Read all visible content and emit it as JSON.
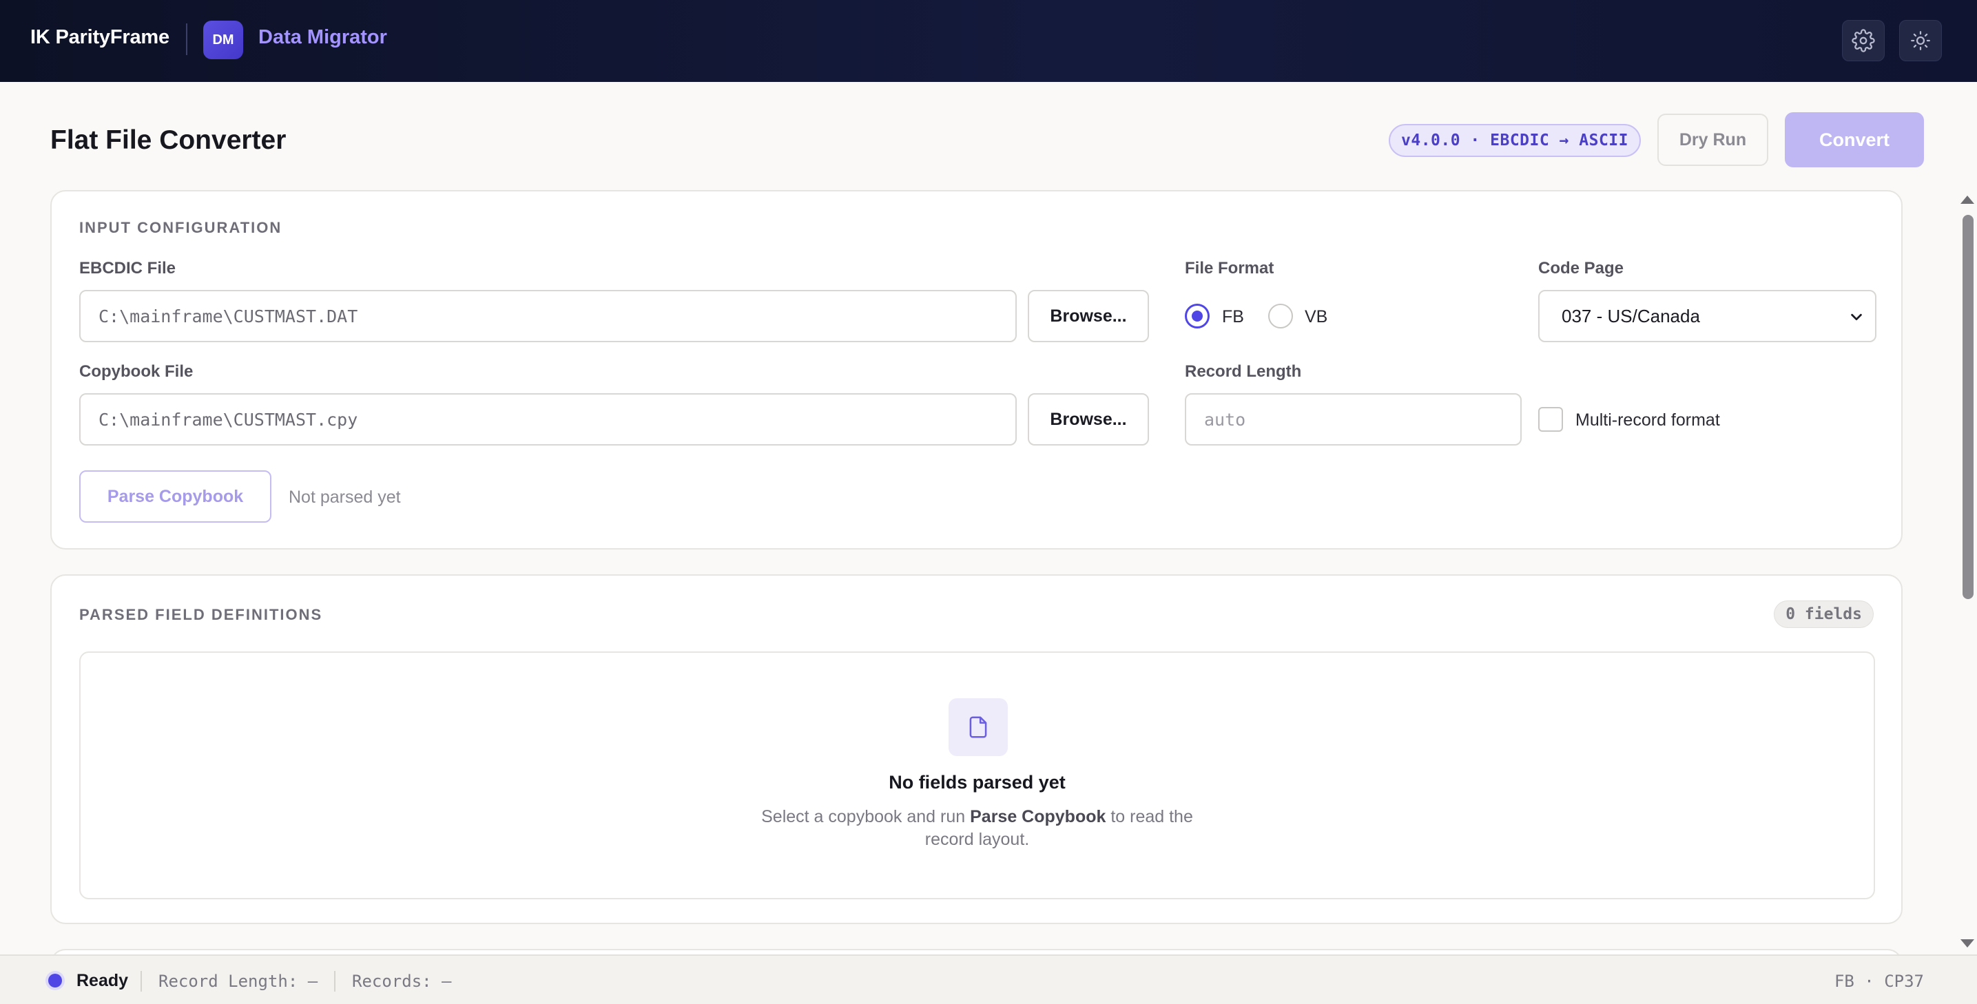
{
  "topbar": {
    "brand": "IK ParityFrame",
    "app_badge": "DM",
    "app_name": "Data Migrator",
    "icons": [
      "gear-icon",
      "sun-icon"
    ]
  },
  "header": {
    "title": "Flat File Converter",
    "version": "v4.0.0 · EBCDIC → ASCII",
    "dry_run_label": "Dry Run",
    "convert_label": "Convert"
  },
  "input_config": {
    "section_label": "INPUT CONFIGURATION",
    "ebcdic_label": "EBCDIC File",
    "ebcdic_value": "C:\\mainframe\\CUSTMAST.DAT",
    "browse_label": "Browse...",
    "copybook_label": "Copybook File",
    "copybook_value": "C:\\mainframe\\CUSTMAST.cpy",
    "file_format_label": "File Format",
    "format_options": [
      "FB",
      "VB"
    ],
    "format_selected": "FB",
    "code_page_label": "Code Page",
    "code_page_value": "037 - US/Canada",
    "record_length_label": "Record Length",
    "record_length_placeholder": "auto",
    "multi_record_label": "Multi-record format",
    "multi_record_checked": false,
    "parse_button": "Parse Copybook",
    "parse_status": "Not parsed yet"
  },
  "parsed_fields": {
    "section_label": "PARSED FIELD DEFINITIONS",
    "count": "0 fields",
    "empty_title": "No fields parsed yet",
    "empty_desc_pre": "Select a copybook and run ",
    "empty_desc_bold": "Parse Copybook",
    "empty_desc_post": " to read the",
    "empty_desc_line2": "record layout."
  },
  "statusbar": {
    "status": "Ready",
    "record_length": "Record Length: —",
    "records": "Records: —",
    "right": "FB · CP37"
  },
  "colors": {
    "accent": "#4f46e5",
    "topbar_bg": "#0d1126",
    "app_name": "#a394ff",
    "convert_disabled": "#bfb7f3"
  }
}
